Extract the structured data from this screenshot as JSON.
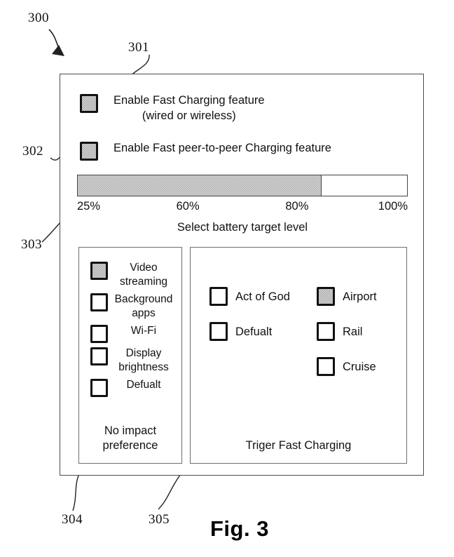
{
  "figure": {
    "caption": "Fig. 3",
    "ref_300": "300",
    "ref_301": "301",
    "ref_302": "302",
    "ref_303": "303",
    "ref_304": "304",
    "ref_305": "305"
  },
  "features": [
    {
      "label": "Enable Fast Charging feature\n(wired or wireless)",
      "checked": true
    },
    {
      "label": "Enable Fast peer-to-peer Charging feature",
      "checked": true
    }
  ],
  "battery_slider": {
    "caption": "Select battery target level",
    "value": 80,
    "min": 25,
    "max": 100,
    "fill_percent": 74,
    "ticks": [
      {
        "label": "25%",
        "position_percent": 0
      },
      {
        "label": "60%",
        "position_percent": 33.5
      },
      {
        "label": "80%",
        "position_percent": 66.5
      },
      {
        "label": "100%",
        "position_percent": 100
      }
    ]
  },
  "no_impact_panel": {
    "caption": "No impact\npreference",
    "options": [
      {
        "label": "Video\nstreaming",
        "checked": true
      },
      {
        "label": "Background\napps",
        "checked": false
      },
      {
        "label": "Wi-Fi",
        "checked": false
      },
      {
        "label": "Display\nbrightness",
        "checked": false
      },
      {
        "label": "Defualt",
        "checked": false
      }
    ]
  },
  "trigger_panel": {
    "caption": "Triger Fast Charging",
    "options": [
      {
        "label": "Act of God",
        "checked": false
      },
      {
        "label": "Defualt",
        "checked": false
      },
      {
        "label": "Airport",
        "checked": true
      },
      {
        "label": "Rail",
        "checked": false
      },
      {
        "label": "Cruise",
        "checked": false
      }
    ]
  }
}
